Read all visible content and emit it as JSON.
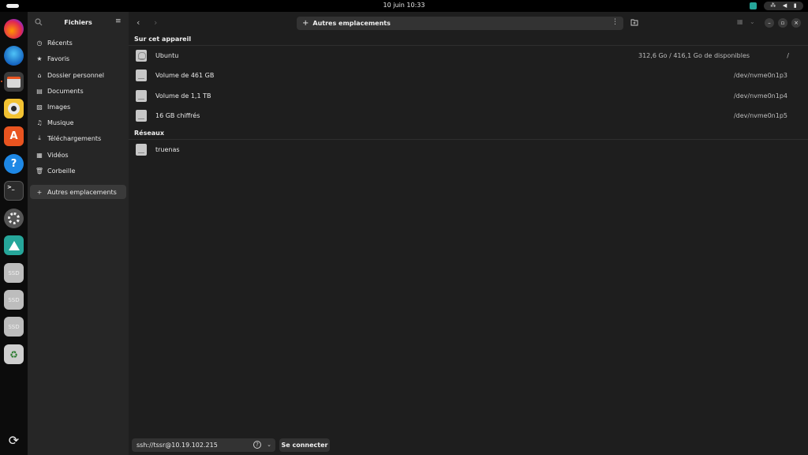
{
  "topbar": {
    "clock": "10 juin  10:33"
  },
  "dock": {
    "icons": [
      "firefox-icon",
      "thunderbird-icon",
      "files-icon",
      "rhythmbox-icon",
      "app-center-icon",
      "help-icon",
      "terminal-icon",
      "settings-icon",
      "nordvpn-icon",
      "ssd-icon",
      "ssd-icon",
      "ssd-icon",
      "trash-icon",
      "show-apps-icon"
    ],
    "ssd_label": "SSD",
    "help_label": "?",
    "terminal_label": ">_",
    "appcenter_label": "A"
  },
  "sidebar": {
    "title": "Fichiers",
    "items": [
      {
        "label": "Récents",
        "icon": "clock-icon"
      },
      {
        "label": "Favoris",
        "icon": "star-icon"
      },
      {
        "label": "Dossier personnel",
        "icon": "home-icon"
      },
      {
        "label": "Documents",
        "icon": "document-icon"
      },
      {
        "label": "Images",
        "icon": "image-icon"
      },
      {
        "label": "Musique",
        "icon": "music-icon"
      },
      {
        "label": "Téléchargements",
        "icon": "download-icon"
      },
      {
        "label": "Vidéos",
        "icon": "video-icon"
      },
      {
        "label": "Corbeille",
        "icon": "trash-icon"
      }
    ],
    "other_locations": "Autres emplacements"
  },
  "header": {
    "path_label": "Autres emplacements"
  },
  "main": {
    "section_device": "Sur cet appareil",
    "section_network": "Réseaux",
    "devices": [
      {
        "name": "Ubuntu",
        "space": "312,6 Go / 416,1 Go de disponibles",
        "mount": "/"
      },
      {
        "name": "Volume de 461 GB",
        "space": "",
        "mount": "/dev/nvme0n1p3"
      },
      {
        "name": "Volume de 1,1 TB",
        "space": "",
        "mount": "/dev/nvme0n1p4"
      },
      {
        "name": "16 GB chiffrés",
        "space": "",
        "mount": "/dev/nvme0n1p5"
      }
    ],
    "networks": [
      {
        "name": "truenas"
      }
    ]
  },
  "connect": {
    "address": "ssh://tssr@10.19.102.215",
    "button": "Se connecter"
  },
  "colors": {
    "accent": "#e95420",
    "sidebar_bg": "#262626",
    "main_bg": "#1e1e1e"
  }
}
